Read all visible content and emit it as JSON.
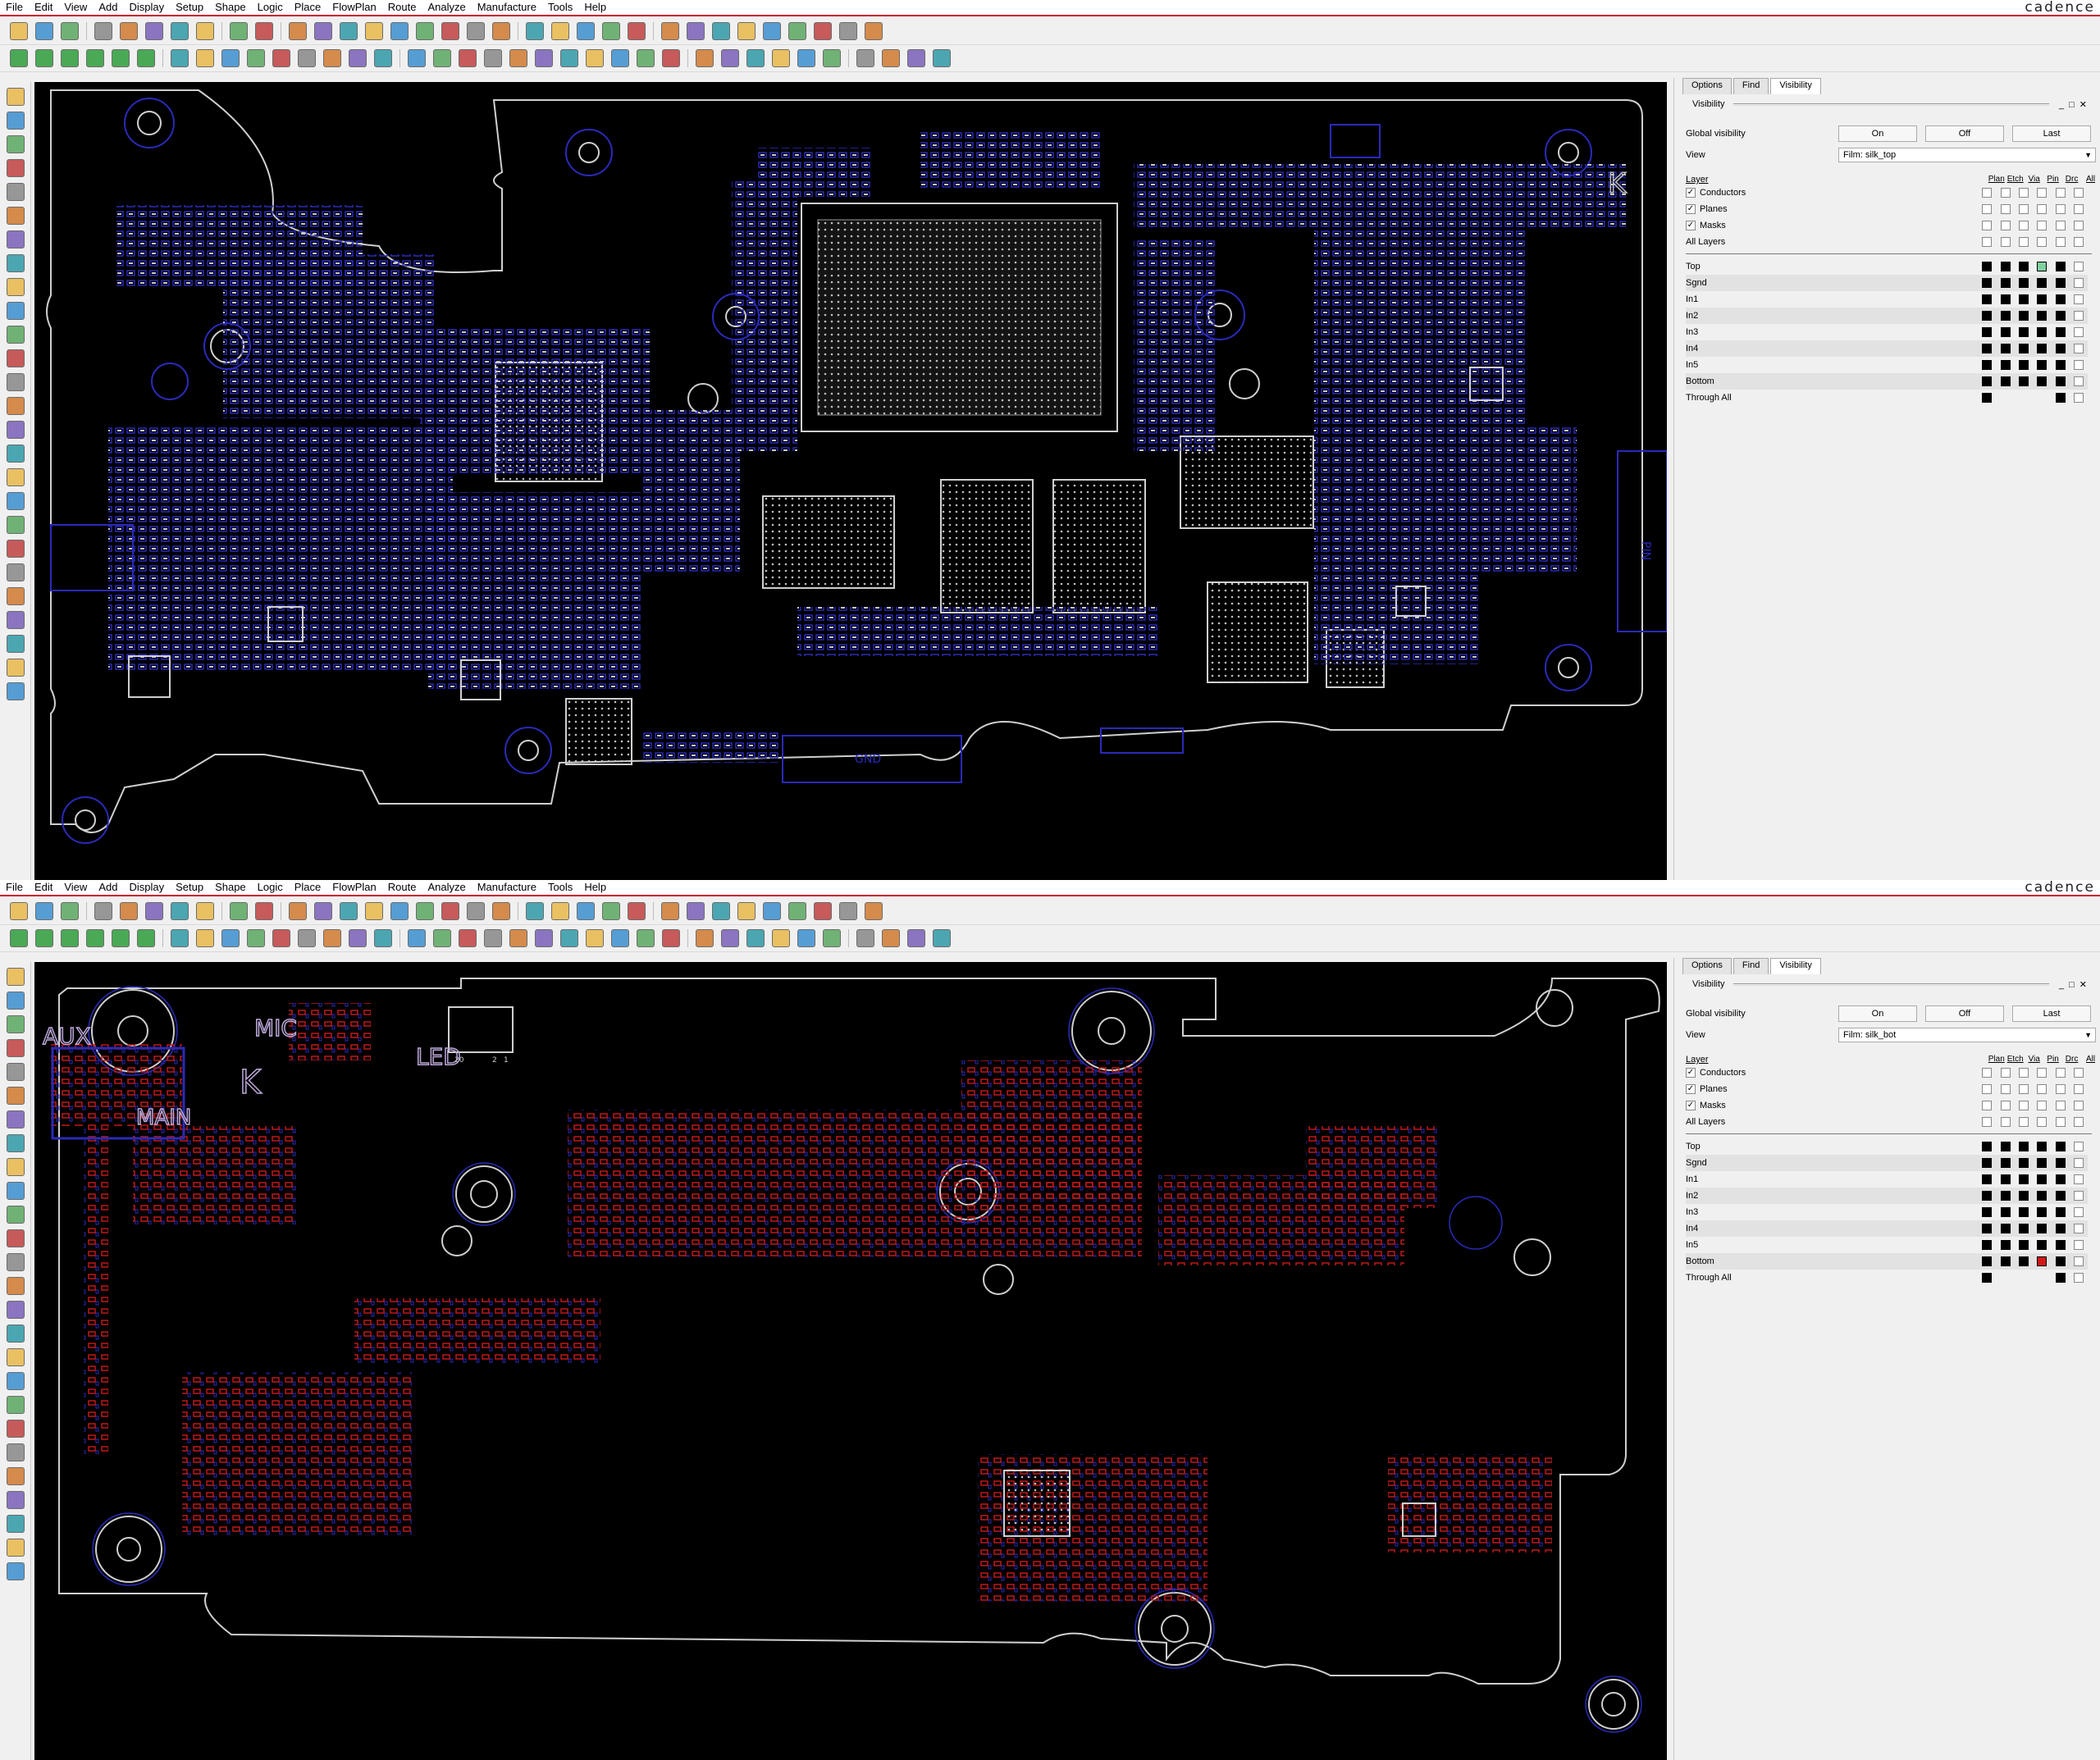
{
  "app": {
    "brand": "cadence"
  },
  "menu": [
    "File",
    "Edit",
    "View",
    "Add",
    "Display",
    "Setup",
    "Shape",
    "Logic",
    "Place",
    "FlowPlan",
    "Route",
    "Analyze",
    "Manufacture",
    "Tools",
    "Help"
  ],
  "panes": [
    {
      "id": "top",
      "tabs": [
        "Options",
        "Find",
        "Visibility"
      ],
      "active_tab": "Visibility",
      "panel_title": "Visibility",
      "global_visibility": {
        "label": "Global visibility",
        "buttons": [
          "On",
          "Off",
          "Last"
        ]
      },
      "view": {
        "label": "View",
        "value": "Film: silk_top"
      },
      "layer_header": "Layer",
      "columns": [
        "Plan",
        "Etch",
        "Via",
        "Pin",
        "Drc",
        "All"
      ],
      "groups": [
        {
          "name": "Conductors",
          "checked": true
        },
        {
          "name": "Planes",
          "checked": true
        },
        {
          "name": "Masks",
          "checked": true
        },
        {
          "name": "All Layers",
          "checked": null
        }
      ],
      "layers": [
        {
          "name": "Top",
          "cells": [
            "on",
            "on",
            "on",
            "hi",
            "on",
            "off"
          ]
        },
        {
          "name": "Sgnd",
          "cells": [
            "on",
            "on",
            "on",
            "on",
            "on",
            "off"
          ]
        },
        {
          "name": "In1",
          "cells": [
            "on",
            "on",
            "on",
            "on",
            "on",
            "off"
          ]
        },
        {
          "name": "In2",
          "cells": [
            "on",
            "on",
            "on",
            "on",
            "on",
            "off"
          ]
        },
        {
          "name": "In3",
          "cells": [
            "on",
            "on",
            "on",
            "on",
            "on",
            "off"
          ]
        },
        {
          "name": "In4",
          "cells": [
            "on",
            "on",
            "on",
            "on",
            "on",
            "off"
          ]
        },
        {
          "name": "In5",
          "cells": [
            "on",
            "on",
            "on",
            "on",
            "on",
            "off"
          ]
        },
        {
          "name": "Bottom",
          "cells": [
            "on",
            "on",
            "on",
            "on",
            "on",
            "off"
          ]
        },
        {
          "name": "Through All",
          "cells": [
            "on",
            "none",
            "none",
            "none",
            "on",
            "off"
          ]
        }
      ],
      "highlight_color": "#7fd0a0",
      "board_labels": [
        {
          "name": "logo-k",
          "text": "K"
        },
        {
          "name": "label-gnd",
          "text": "GND"
        },
        {
          "name": "label-pin",
          "text": "PIN"
        }
      ]
    },
    {
      "id": "bot",
      "tabs": [
        "Options",
        "Find",
        "Visibility"
      ],
      "active_tab": "Visibility",
      "panel_title": "Visibility",
      "global_visibility": {
        "label": "Global visibility",
        "buttons": [
          "On",
          "Off",
          "Last"
        ]
      },
      "view": {
        "label": "View",
        "value": "Film: silk_bot"
      },
      "layer_header": "Layer",
      "columns": [
        "Plan",
        "Etch",
        "Via",
        "Pin",
        "Drc",
        "All"
      ],
      "groups": [
        {
          "name": "Conductors",
          "checked": true
        },
        {
          "name": "Planes",
          "checked": true
        },
        {
          "name": "Masks",
          "checked": true
        },
        {
          "name": "All Layers",
          "checked": null
        }
      ],
      "layers": [
        {
          "name": "Top",
          "cells": [
            "on",
            "on",
            "on",
            "on",
            "on",
            "off"
          ]
        },
        {
          "name": "Sgnd",
          "cells": [
            "on",
            "on",
            "on",
            "on",
            "on",
            "off"
          ]
        },
        {
          "name": "In1",
          "cells": [
            "on",
            "on",
            "on",
            "on",
            "on",
            "off"
          ]
        },
        {
          "name": "In2",
          "cells": [
            "on",
            "on",
            "on",
            "on",
            "on",
            "off"
          ]
        },
        {
          "name": "In3",
          "cells": [
            "on",
            "on",
            "on",
            "on",
            "on",
            "off"
          ]
        },
        {
          "name": "In4",
          "cells": [
            "on",
            "on",
            "on",
            "on",
            "on",
            "off"
          ]
        },
        {
          "name": "In5",
          "cells": [
            "on",
            "on",
            "on",
            "on",
            "on",
            "off"
          ]
        },
        {
          "name": "Bottom",
          "cells": [
            "on",
            "on",
            "on",
            "hi",
            "on",
            "off"
          ]
        },
        {
          "name": "Through All",
          "cells": [
            "on",
            "none",
            "none",
            "none",
            "on",
            "off"
          ]
        }
      ],
      "highlight_color": "#d01818",
      "board_labels": [
        {
          "name": "label-aux",
          "text": "AUX"
        },
        {
          "name": "label-mic",
          "text": "MIC"
        },
        {
          "name": "label-led",
          "text": "LED"
        },
        {
          "name": "label-main",
          "text": "MAIN"
        },
        {
          "name": "logo-k",
          "text": "K"
        },
        {
          "name": "connector-pin-20",
          "text": "20"
        },
        {
          "name": "connector-pin-2",
          "text": "2"
        },
        {
          "name": "connector-pin-1",
          "text": "1"
        }
      ]
    }
  ],
  "toolbar_icons": {
    "row1": [
      "new-file-icon",
      "open-folder-icon",
      "save-icon",
      "separator",
      "move-icon",
      "copy-icon",
      "delete-icon",
      "undo-icon",
      "redo-icon",
      "separator",
      "connect-icon",
      "add-connect-icon",
      "separator",
      "grid-icon",
      "zoom-fit-icon",
      "zoom-in-icon",
      "zoom-out-icon",
      "zoom-world-icon",
      "zoom-previous-icon",
      "zoom-center-icon",
      "redraw-icon",
      "3d-view-icon",
      "separator",
      "grid-toggle-icon",
      "color-icon",
      "shadow-icon",
      "layer-icon",
      "display-icon",
      "separator",
      "info-icon",
      "measure-icon",
      "ruler-icon",
      "highlight-icon",
      "dehighlight-icon",
      "sun-icon",
      "show-element-icon",
      "drc-icon",
      "stats-icon"
    ],
    "row2": [
      "green-layer-1-icon",
      "green-layer-2-icon",
      "green-layer-3-icon",
      "green-layer-4-icon",
      "green-layer-5-icon",
      "green-layer-6-icon",
      "separator",
      "place-icon",
      "shape-rect-icon",
      "shape-circle-icon",
      "shape-select-icon",
      "shape-merge-icon",
      "shape-void-icon",
      "shape-edit-icon",
      "shape-delete-icon",
      "shape-fill-icon",
      "separator",
      "dimension-icon",
      "dim-linear-icon",
      "dim-angle-icon",
      "text-edit-icon",
      "glossing-icon",
      "via-icon",
      "fanout-icon",
      "array-icon",
      "flag-icon",
      "bus-icon",
      "groups-icon",
      "separator",
      "route-icon",
      "slide-icon",
      "spread-icon",
      "phase-icon",
      "delay-icon",
      "vertex-icon",
      "separator",
      "drill-icon",
      "artwork-icon",
      "nc-icon",
      "help-icon"
    ],
    "left": [
      "add-pin-icon",
      "part-icon",
      "chip-icon",
      "line-icon",
      "cline-icon",
      "via-add-icon",
      "route-add-icon",
      "fanout-add-icon",
      "autoroute-icon",
      "bundle-icon",
      "shape-add-icon",
      "rect-add-icon",
      "frect-add-icon",
      "text-add-icon",
      "net-icon",
      "highlight-net-icon",
      "ratsnest-icon",
      "show-ratsnest-icon",
      "swap-icon",
      "drc-mark-icon",
      "layers-icon",
      "ground-icon",
      "power-icon",
      "check-icon",
      "report-icon",
      "export-icon"
    ]
  }
}
